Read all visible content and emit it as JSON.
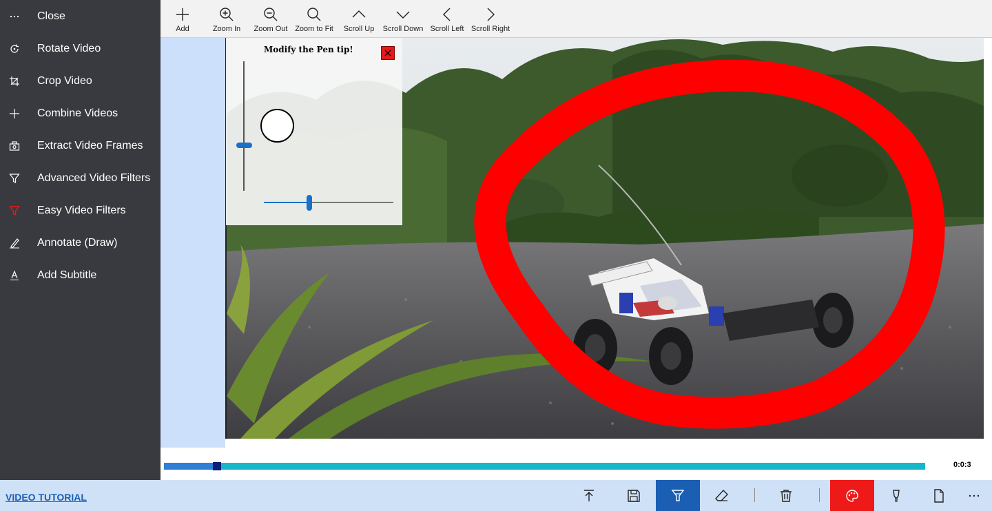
{
  "sidebar": {
    "items": [
      {
        "label": "Close",
        "icon": "more-icon"
      },
      {
        "label": "Rotate Video",
        "icon": "rotate-icon"
      },
      {
        "label": "Crop Video",
        "icon": "crop-icon"
      },
      {
        "label": "Combine Videos",
        "icon": "plus-icon"
      },
      {
        "label": "Extract Video Frames",
        "icon": "extract-frames-icon"
      },
      {
        "label": "Advanced Video Filters",
        "icon": "filter-icon"
      },
      {
        "label": "Easy Video Filters",
        "icon": "filter-red-icon"
      },
      {
        "label": "Annotate (Draw)",
        "icon": "pen-draw-icon"
      },
      {
        "label": "Add Subtitle",
        "icon": "subtitle-icon"
      }
    ]
  },
  "toolbar": {
    "buttons": [
      {
        "label": "Add",
        "icon": "plus-icon"
      },
      {
        "label": "Zoom In",
        "icon": "zoom-in-icon"
      },
      {
        "label": "Zoom Out",
        "icon": "zoom-out-icon"
      },
      {
        "label": "Zoom to Fit",
        "icon": "zoom-fit-icon"
      },
      {
        "label": "Scroll Up",
        "icon": "chevron-up-icon"
      },
      {
        "label": "Scroll Down",
        "icon": "chevron-down-icon"
      },
      {
        "label": "Scroll Left",
        "icon": "chevron-left-icon"
      },
      {
        "label": "Scroll Right",
        "icon": "chevron-right-icon"
      }
    ]
  },
  "pen_popup": {
    "title": "Modify the Pen tip!",
    "size_level": 0.35,
    "opacity_level": 0.35
  },
  "timeline": {
    "progress": 0.07,
    "time": "0:0:3"
  },
  "bottom_bar": {
    "tutorial_link": "VIDEO TUTORIAL",
    "buttons": [
      {
        "icon": "upload-icon"
      },
      {
        "icon": "save-icon"
      },
      {
        "icon": "pen-tool-icon",
        "active": true
      },
      {
        "icon": "eraser-icon"
      },
      {
        "icon": "trash-icon"
      },
      {
        "icon": "palette-icon",
        "highlight": true
      },
      {
        "icon": "highlighter-icon"
      },
      {
        "icon": "new-page-icon"
      },
      {
        "icon": "more-icon"
      }
    ]
  },
  "colors": {
    "sidebar_bg": "#393a3f",
    "accent_blue": "#2f7fd6",
    "active_tool": "#1a5fb4",
    "pen_color": "#ff0000",
    "timeline": "#17b7c9"
  }
}
